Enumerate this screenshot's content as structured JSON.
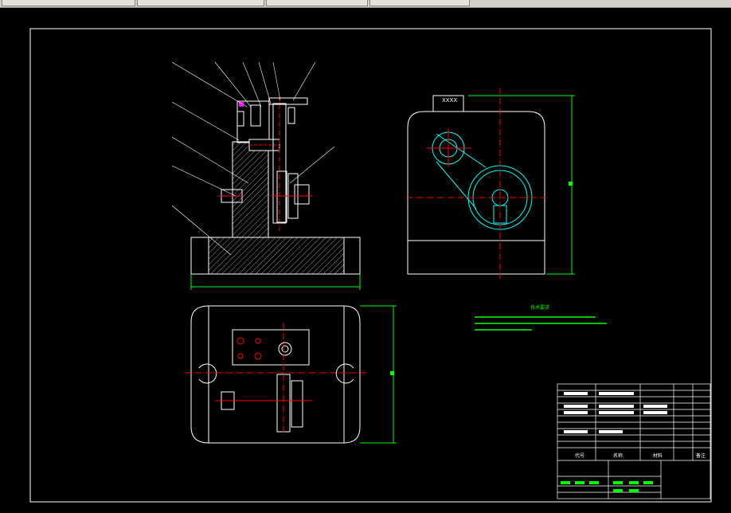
{
  "tabs": [
    {
      "label": ""
    },
    {
      "label": ""
    },
    {
      "label": ""
    },
    {
      "label": ""
    }
  ],
  "drawing": {
    "part_callouts": [],
    "dimension_text": "",
    "top_block_label": "XXXX",
    "notes_title": "技术要求",
    "notes_lines": [
      "",
      "",
      ""
    ]
  },
  "title_block": {
    "headers": [
      "代号",
      "名称",
      "材料",
      "备注"
    ]
  },
  "colors": {
    "outline": "#ffffff",
    "centerline": "#ff0000",
    "hatch": "#ffffff",
    "dimension": "#00ff00",
    "feature": "#00ffff",
    "marker": "#ff00ff"
  }
}
